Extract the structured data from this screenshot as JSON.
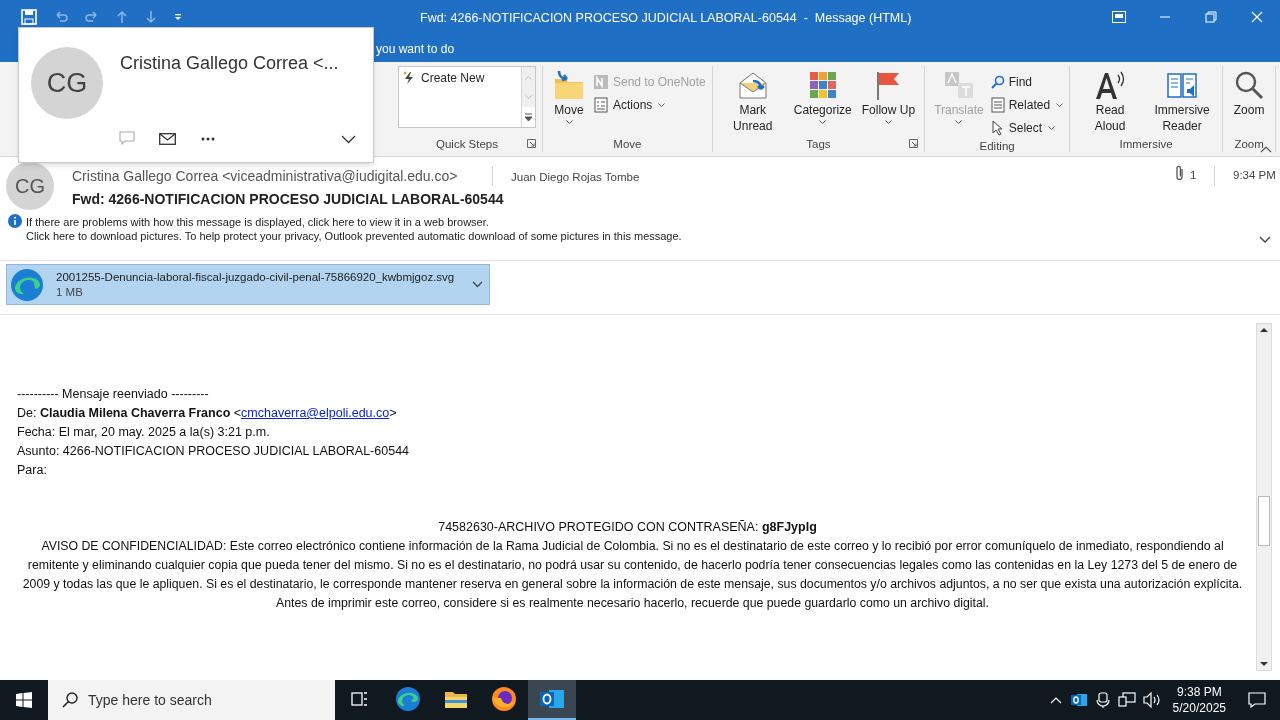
{
  "window": {
    "title": "Fwd: 4266-NOTIFICACION PROCESO JUDICIAL LABORAL-60544  -  Message (HTML)"
  },
  "tell_me": {
    "text": "you want to do"
  },
  "ribbon": {
    "groups": [
      {
        "label": "Quick Steps",
        "launcher": true,
        "items": [
          {
            "kind": "gallery",
            "label": "Create New",
            "disabled": false
          }
        ]
      },
      {
        "label": "Move",
        "launcher": false,
        "items": [
          {
            "kind": "large",
            "label": "Move",
            "dropdown": true,
            "disabled": false
          },
          {
            "kind": "small",
            "label": "Send to OneNote",
            "dropdown": false,
            "disabled": true
          },
          {
            "kind": "small",
            "label": "Actions",
            "dropdown": true,
            "disabled": false
          }
        ]
      },
      {
        "label": "Tags",
        "launcher": true,
        "items": [
          {
            "kind": "large",
            "label": "Mark Unread",
            "dropdown": false,
            "disabled": false
          },
          {
            "kind": "large",
            "label": "Categorize",
            "dropdown": true,
            "disabled": false
          },
          {
            "kind": "large",
            "label": "Follow Up",
            "dropdown": true,
            "disabled": false
          }
        ]
      },
      {
        "label": "Editing",
        "launcher": false,
        "items": [
          {
            "kind": "large",
            "label": "Translate",
            "dropdown": true,
            "disabled": true
          },
          {
            "kind": "small",
            "label": "Find",
            "dropdown": false,
            "disabled": false
          },
          {
            "kind": "small",
            "label": "Related",
            "dropdown": true,
            "disabled": false
          },
          {
            "kind": "small",
            "label": "Select",
            "dropdown": true,
            "disabled": false
          }
        ]
      },
      {
        "label": "Immersive",
        "launcher": false,
        "items": [
          {
            "kind": "large",
            "label": "Read Aloud",
            "dropdown": false,
            "disabled": false
          },
          {
            "kind": "large",
            "label": "Immersive Reader",
            "dropdown": false,
            "disabled": false
          }
        ]
      },
      {
        "label": "Zoom",
        "launcher": false,
        "items": [
          {
            "kind": "large",
            "label": "Zoom",
            "dropdown": false,
            "disabled": false
          }
        ]
      }
    ]
  },
  "contact_card": {
    "initials": "CG",
    "name": "Cristina Gallego Correa <..."
  },
  "header": {
    "initials": "CG",
    "from": "Cristina Gallego Correa <viceadministrativa@iudigital.edu.co>",
    "to": "Juan Diego Rojas Tombe",
    "attachment_count": "1",
    "time": "9:34 PM",
    "subject": "Fwd: 4266-NOTIFICACION PROCESO JUDICIAL LABORAL-60544",
    "info": [
      "If there are problems with how this message is displayed, click here to view it in a web browser.",
      "Click here to download pictures. To help protect your privacy, Outlook prevented automatic download of some pictures in this message."
    ]
  },
  "attachment": {
    "name": "2001255-Denuncia-laboral-fiscal-juzgado-civil-penal-75866920_kwbmjgoz.svg",
    "size": "1 MB",
    "selected": true
  },
  "body": {
    "forward_header": "---------- Mensaje reenviado ---------",
    "from": {
      "prefix": "De: **Claudia Milena Chaverra Franco** <",
      "link": "cmchaverra@elpoli.edu.co",
      "suffix": ">"
    },
    "lines": [
      "Fecha: El mar, 20 may. 2025 a la(s) 3:21 p.m.",
      "Asunto: 4266-NOTIFICACION PROCESO JUDICIAL LABORAL-60544",
      "Para:"
    ],
    "password_line": "74582630-ARCHIVO  PROTEGIDO CON CONTRASEÑA: **g8FJyplg**",
    "notice": "AVISO DE CONFIDENCIALIDAD: Este correo electrónico contiene información de la Rama Judicial de Colombia. Si no es el destinatario de este correo y lo recibió por error comuníquelo de inmediato, respondiendo al remitente y eliminando cualquier copia que pueda tener del mismo. Si no es el destinatario, no podrá usar su contenido, de hacerlo podría tener consecuencias legales como las contenidas en la Ley 1273  del 5 de enero de 2009  y todas las que le apliquen. Si es el destinatario, le corresponde mantener reserva en general sobre la información de este mensaje, sus documentos y/o archivos adjuntos, a no ser que exista una autorización explícita. Antes de imprimir este correo, considere si es realmente necesario hacerlo, recuerde que puede guardarlo como un archivo digital."
  },
  "taskbar": {
    "search": {
      "placeholder": "Type here to search"
    },
    "apps": [
      {
        "kind": "taskview",
        "selected": false
      },
      {
        "kind": "edge",
        "selected": false
      },
      {
        "kind": "explorer",
        "selected": false
      },
      {
        "kind": "firefox",
        "selected": false
      },
      {
        "kind": "outlook",
        "selected": true
      }
    ],
    "time": "9:38 PM",
    "date": "5/20/2025"
  }
}
